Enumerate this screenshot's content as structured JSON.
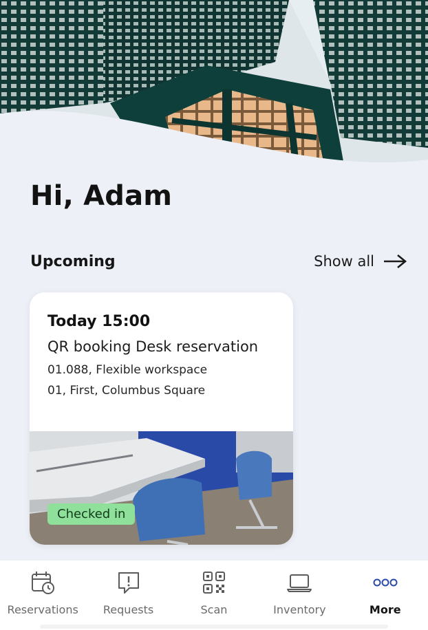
{
  "greeting": "Hi, Adam",
  "upcoming": {
    "title": "Upcoming",
    "show_all": "Show all"
  },
  "card": {
    "time": "Today 15:00",
    "title": "QR booking Desk reservation",
    "location": "01.088, Flexible workspace",
    "building": "01, First, Columbus Square",
    "status": "Checked in"
  },
  "nav": {
    "items": [
      {
        "label": "Reservations",
        "icon": "calendar-clock-icon"
      },
      {
        "label": "Requests",
        "icon": "alert-message-icon"
      },
      {
        "label": "Scan",
        "icon": "qr-code-icon"
      },
      {
        "label": "Inventory",
        "icon": "laptop-icon"
      },
      {
        "label": "More",
        "icon": "more-dots-icon",
        "active": true
      }
    ]
  },
  "colors": {
    "accent": "#2a4aa8",
    "background": "#eef0f8",
    "badge": "#8ee09a"
  }
}
